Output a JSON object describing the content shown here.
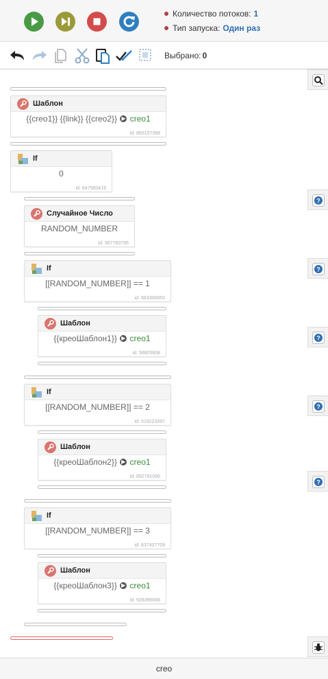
{
  "controls": {
    "threads_label": "Количество потоков:",
    "threads_value": "1",
    "launch_label": "Тип запуска:",
    "launch_value": "Один раз"
  },
  "toolbar": {
    "selected_label": "Выбрано:",
    "selected_value": "0"
  },
  "blocks": [
    {
      "title": "Шаблон",
      "tpl_a": "{{creo1}} {{link}} {{creo2}}",
      "result": "creo1",
      "id": "id: 865157398"
    },
    {
      "title": "If",
      "expr": "0",
      "id": "id: 647560419"
    },
    {
      "title": "Случайное Число",
      "expr": "RANDOM_NUMBER",
      "id": "id: 567760785"
    },
    {
      "title": "If",
      "expr": "[[RANDOM_NUMBER]] == 1",
      "id": "id: 683306950"
    },
    {
      "title": "Шаблон",
      "tpl_a": "{{креоШаблон1}}",
      "result": "creo1",
      "id": "id: 56805608"
    },
    {
      "title": "If",
      "expr": "[[RANDOM_NUMBER]] == 2",
      "id": "id: 519223397"
    },
    {
      "title": "Шаблон",
      "tpl_a": "{{креоШаблон2}}",
      "result": "creo1",
      "id": "id: 892791095"
    },
    {
      "title": "If",
      "expr": "[[RANDOM_NUMBER]] == 3",
      "id": "id: 637437709"
    },
    {
      "title": "Шаблон",
      "tpl_a": "{{креоШаблон3}}",
      "result": "creo1",
      "id": "id: 928396668"
    }
  ],
  "status": {
    "text": "creo"
  },
  "colors": {
    "play": "#4a9a45",
    "step": "#9a9a3a",
    "stop": "#d34b4b",
    "restart": "#2f7fc1",
    "accent": "#2f6fb3"
  },
  "icons": [
    "play-icon",
    "step-forward-icon",
    "stop-icon",
    "restart-icon",
    "undo-icon",
    "redo-icon",
    "copy-icon",
    "cut-icon",
    "paste-icon",
    "check-all-icon",
    "select-box-icon",
    "search-icon",
    "help-icon",
    "bug-icon"
  ]
}
